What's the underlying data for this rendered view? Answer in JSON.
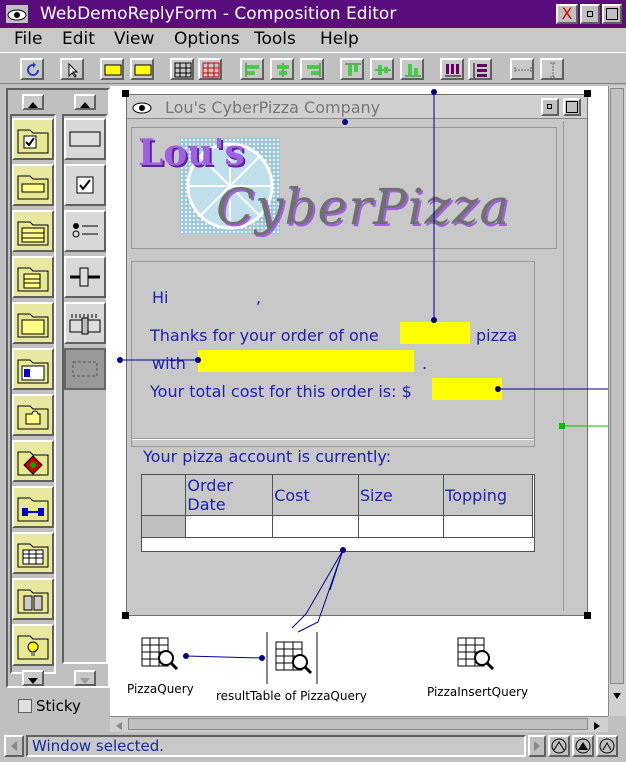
{
  "window": {
    "title": "WebDemoReplyForm - Composition Editor"
  },
  "menu": {
    "items": [
      "File",
      "Edit",
      "View",
      "Options",
      "Tools",
      "Help"
    ]
  },
  "palette": {
    "sticky_label": "Sticky"
  },
  "form": {
    "window_title": "Lou's CyberPizza Company",
    "logo_top": "Lou's",
    "logo_bottom": "CyberPizza",
    "hi_label": "Hi",
    "comma": ",",
    "thanks_label": "Thanks for your order of one",
    "pizza_label": "pizza",
    "with_label": "with",
    "period": ".",
    "total_label": "Your total cost for this order is: $",
    "account_label": "Your pizza account is currently:",
    "table_headers": [
      "Order Date",
      "Cost",
      "Size",
      "Topping"
    ]
  },
  "nonvisual": {
    "items": [
      "PizzaQuery",
      "resultTable of PizzaQuery",
      "PizzaInsertQuery"
    ]
  },
  "status": {
    "text": "Window selected."
  },
  "colors": {
    "titlebar": "#5a0e7e",
    "form_text": "#2020b0",
    "highlight": "#ffff00",
    "connection": "#00008b"
  }
}
